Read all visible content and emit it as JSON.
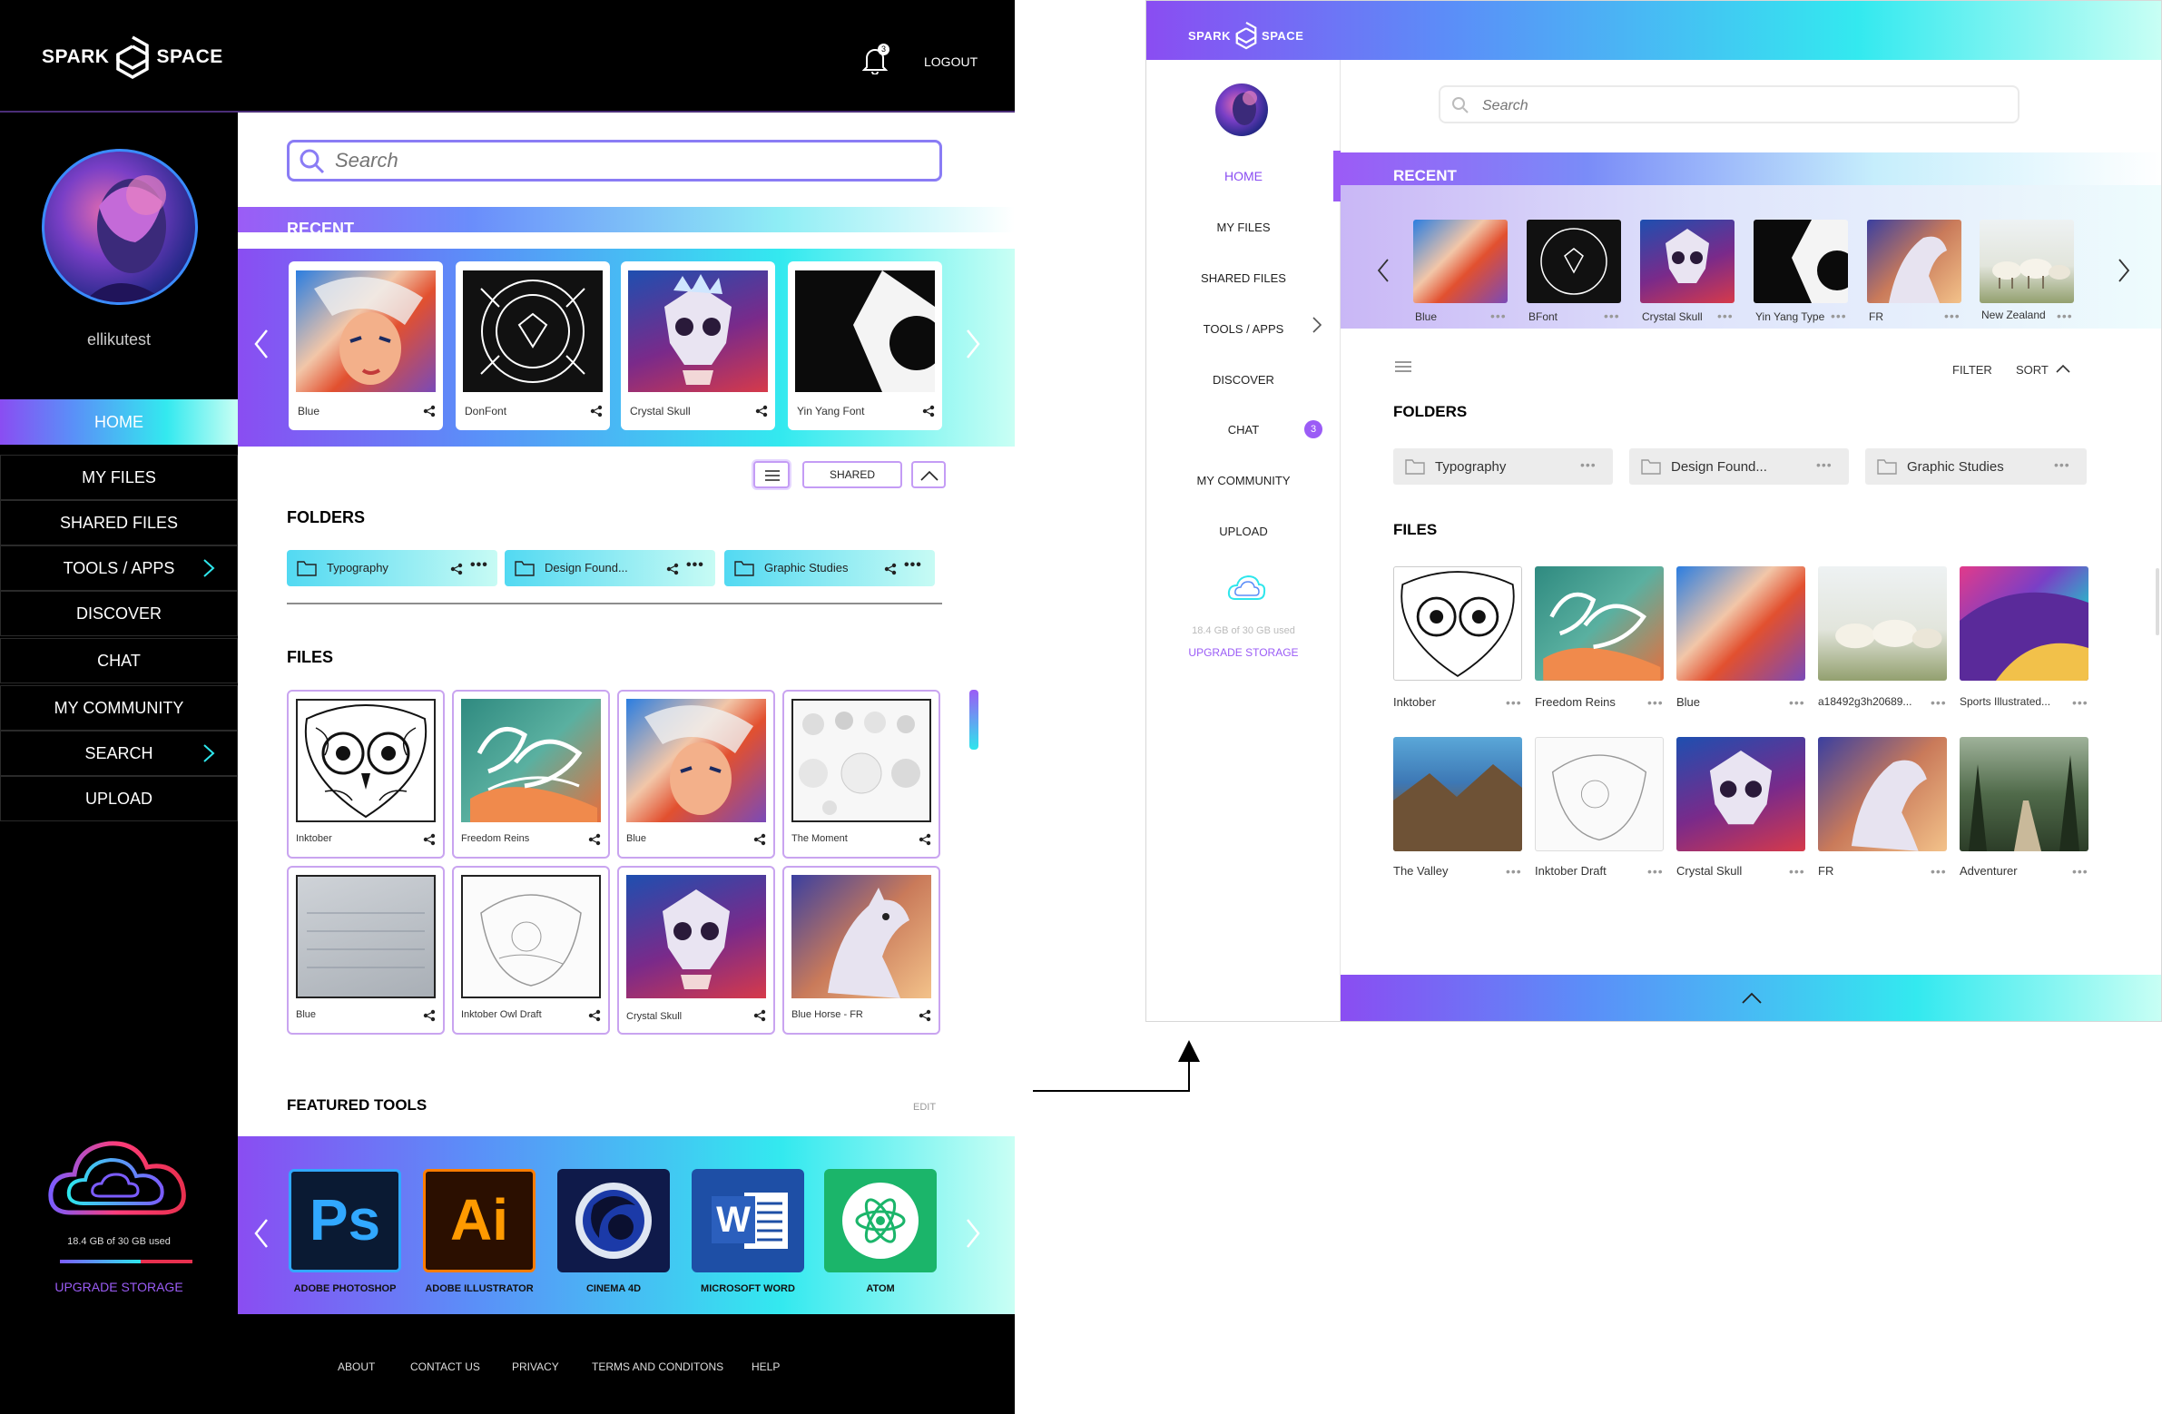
{
  "brand": {
    "left": "SPARK",
    "right": "SPACE"
  },
  "desktop": {
    "header": {
      "logout": "LOGOUT",
      "notification_count": "3"
    },
    "user": {
      "name": "ellikutest"
    },
    "nav": [
      {
        "label": "HOME",
        "active": true
      },
      {
        "label": "MY FILES"
      },
      {
        "label": "SHARED FILES"
      },
      {
        "label": "TOOLS / APPS",
        "has_chevron": true
      },
      {
        "label": "DISCOVER"
      },
      {
        "label": "CHAT"
      },
      {
        "label": "MY COMMUNITY"
      },
      {
        "label": "SEARCH",
        "has_chevron": true
      },
      {
        "label": "UPLOAD"
      }
    ],
    "storage": {
      "text": "18.4 GB of 30 GB used",
      "fraction": 0.613,
      "upgrade": "UPGRADE STORAGE"
    },
    "search": {
      "placeholder": "Search"
    },
    "recent": {
      "title": "RECENT",
      "items": [
        {
          "label": "Blue"
        },
        {
          "label": "DonFont"
        },
        {
          "label": "Crystal Skull"
        },
        {
          "label": "Yin Yang Font"
        }
      ]
    },
    "controls": {
      "shared": "SHARED"
    },
    "folders": {
      "title": "FOLDERS",
      "items": [
        {
          "label": "Typography"
        },
        {
          "label": "Design Found..."
        },
        {
          "label": "Graphic Studies"
        }
      ]
    },
    "files": {
      "title": "FILES",
      "items": [
        {
          "label": "Inktober"
        },
        {
          "label": "Freedom Reins"
        },
        {
          "label": "Blue"
        },
        {
          "label": "The Moment"
        },
        {
          "label": "Blue"
        },
        {
          "label": "Inktober Owl Draft"
        },
        {
          "label": "Crystal Skull"
        },
        {
          "label": "Blue Horse - FR"
        }
      ]
    },
    "featured": {
      "title": "FEATURED TOOLS",
      "edit": "EDIT",
      "tools": [
        {
          "label": "ADOBE PHOTOSHOP",
          "glyph": "Ps"
        },
        {
          "label": "ADOBE ILLUSTRATOR",
          "glyph": "Ai"
        },
        {
          "label": "CINEMA 4D"
        },
        {
          "label": "MICROSOFT WORD",
          "glyph": "W"
        },
        {
          "label": "ATOM"
        }
      ]
    },
    "footer": [
      "ABOUT",
      "CONTACT US",
      "PRIVACY",
      "TERMS AND CONDITONS",
      "HELP"
    ]
  },
  "tablet": {
    "nav": [
      {
        "label": "HOME",
        "active": true
      },
      {
        "label": "MY FILES"
      },
      {
        "label": "SHARED FILES"
      },
      {
        "label": "TOOLS / APPS",
        "has_chevron": true
      },
      {
        "label": "DISCOVER"
      },
      {
        "label": "CHAT",
        "badge": "3"
      },
      {
        "label": "MY COMMUNITY"
      },
      {
        "label": "UPLOAD"
      }
    ],
    "storage": {
      "text": "18.4 GB of 30 GB used",
      "upgrade": "UPGRADE STORAGE"
    },
    "search": {
      "placeholder": "Search"
    },
    "recent": {
      "title": "RECENT",
      "items": [
        {
          "label": "Blue"
        },
        {
          "label": "BFont"
        },
        {
          "label": "Crystal Skull"
        },
        {
          "label": "Yin Yang Type"
        },
        {
          "label": "FR"
        },
        {
          "label": "New Zealand"
        }
      ]
    },
    "controls": {
      "filter": "FILTER",
      "sort": "SORT"
    },
    "folders": {
      "title": "FOLDERS",
      "items": [
        {
          "label": "Typography"
        },
        {
          "label": "Design Found..."
        },
        {
          "label": "Graphic Studies"
        }
      ]
    },
    "files": {
      "title": "FILES",
      "items": [
        {
          "label": "Inktober"
        },
        {
          "label": "Freedom Reins"
        },
        {
          "label": "Blue"
        },
        {
          "label": "a18492g3h20689..."
        },
        {
          "label": "Sports Illustrated..."
        },
        {
          "label": "The Valley"
        },
        {
          "label": "Inktober Draft"
        },
        {
          "label": "Crystal Skull"
        },
        {
          "label": "FR"
        },
        {
          "label": "Adventurer"
        }
      ]
    }
  },
  "colors": {
    "accent_purple": "#9b5cf6",
    "accent_cyan": "#2ee6ec",
    "storage_red": "#e8304f"
  }
}
